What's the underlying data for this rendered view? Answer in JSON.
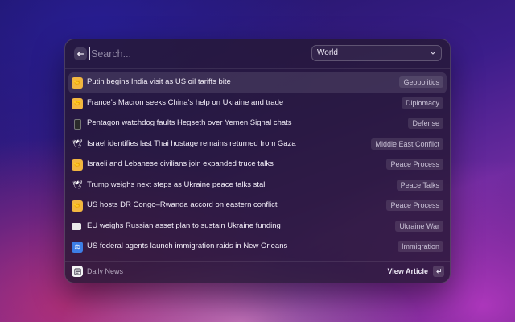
{
  "search": {
    "placeholder": "Search...",
    "value": ""
  },
  "filter": {
    "selected": "World",
    "icon": "chevron-down-icon"
  },
  "articles": [
    {
      "icon": "handshake-icon",
      "title": "Putin begins India visit as US oil tariffs bite",
      "tag": "Geopolitics",
      "selected": true
    },
    {
      "icon": "handshake-icon",
      "title": "France’s Macron seeks China’s help on Ukraine and trade",
      "tag": "Diplomacy",
      "selected": false
    },
    {
      "icon": "phone-icon",
      "title": "Pentagon watchdog faults Hegseth over Yemen Signal chats",
      "tag": "Defense",
      "selected": false
    },
    {
      "icon": "dove-icon",
      "title": "Israel identifies last Thai hostage remains returned from Gaza",
      "tag": "Middle East Conflict",
      "selected": false
    },
    {
      "icon": "handshake-icon",
      "title": "Israeli and Lebanese civilians join expanded truce talks",
      "tag": "Peace Process",
      "selected": false
    },
    {
      "icon": "dove-icon",
      "title": "Trump weighs next steps as Ukraine peace talks stall",
      "tag": "Peace Talks",
      "selected": false
    },
    {
      "icon": "handshake-icon",
      "title": "US hosts DR Congo–Rwanda accord on eastern conflict",
      "tag": "Peace Process",
      "selected": false
    },
    {
      "icon": "flag-icon",
      "title": "EU weighs Russian asset plan to sustain Ukraine funding",
      "tag": "Ukraine War",
      "selected": false
    },
    {
      "icon": "justice-icon",
      "title": "US federal agents launch immigration raids in New Orleans",
      "tag": "Immigration",
      "selected": false
    }
  ],
  "footer": {
    "app_name": "Daily News",
    "app_icon": "newspaper-icon",
    "action_label": "View Article",
    "action_icon": "enter-key-icon"
  }
}
